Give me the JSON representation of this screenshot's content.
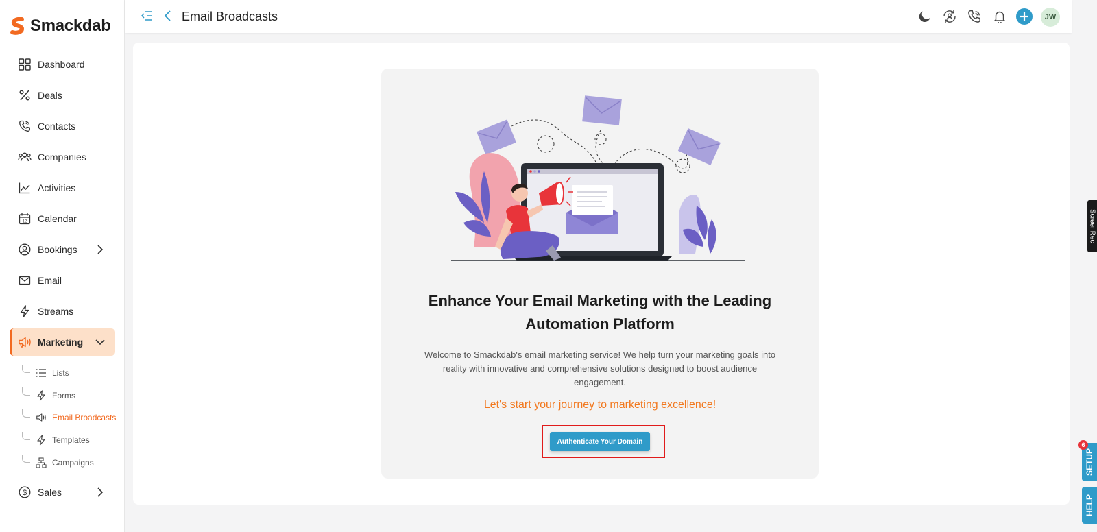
{
  "app": {
    "name": "Smackdab"
  },
  "sidebar": {
    "items": [
      {
        "label": "Dashboard"
      },
      {
        "label": "Deals"
      },
      {
        "label": "Contacts"
      },
      {
        "label": "Companies"
      },
      {
        "label": "Activities"
      },
      {
        "label": "Calendar"
      },
      {
        "label": "Bookings"
      },
      {
        "label": "Email"
      },
      {
        "label": "Streams"
      },
      {
        "label": "Marketing"
      },
      {
        "label": "Sales"
      }
    ],
    "marketing_sub": [
      {
        "label": "Lists"
      },
      {
        "label": "Forms"
      },
      {
        "label": "Email Broadcasts"
      },
      {
        "label": "Templates"
      },
      {
        "label": "Campaigns"
      }
    ]
  },
  "header": {
    "title": "Email Broadcasts",
    "avatar_initials": "JW"
  },
  "main": {
    "headline": "Enhance Your Email Marketing with the Leading Automation Platform",
    "description": "Welcome to Smackdab's email marketing service! We help turn your marketing goals into reality with innovative and comprehensive solutions designed to boost audience engagement.",
    "cta_text": "Let's start your journey to marketing excellence!",
    "button_label": "Authenticate Your Domain"
  },
  "widgets": {
    "screenrec_label": "ScreenRec",
    "setup_label": "SETUP",
    "setup_badge": "6",
    "help_label": "HELP"
  },
  "colors": {
    "brand_orange": "#f26a21",
    "accent_blue": "#2f9bc9",
    "active_bg": "#fde0c9",
    "highlight_red": "#e01b1b"
  }
}
